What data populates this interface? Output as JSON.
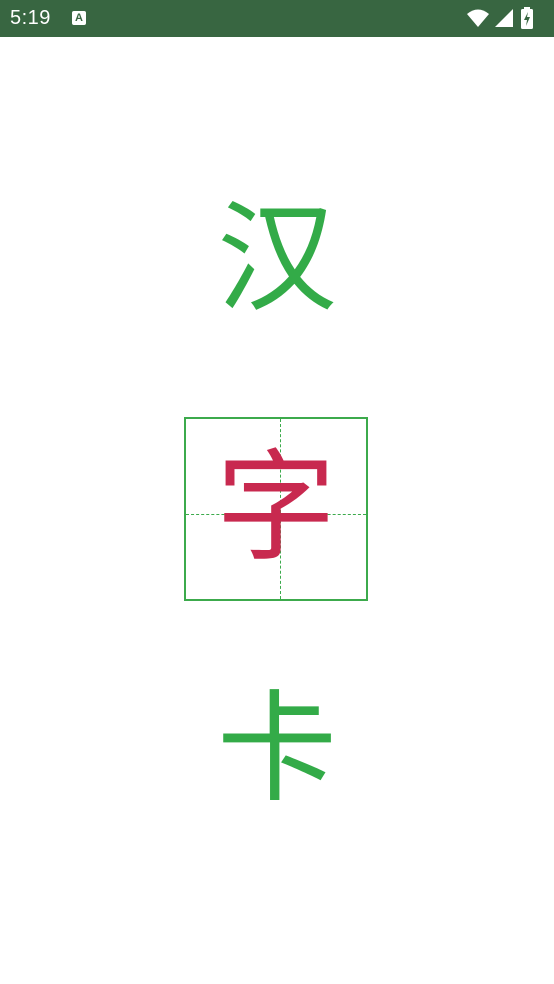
{
  "status_bar": {
    "time": "5:19",
    "notification_icon": "A",
    "icons": [
      "wifi-icon",
      "signal-icon",
      "battery-icon"
    ],
    "background_color": "#386641"
  },
  "characters": {
    "top": "汉",
    "middle": "字",
    "bottom": "卡"
  },
  "colors": {
    "character_green": "#33ab48",
    "highlight_red": "#c8294f",
    "grid_green": "#3caa4c"
  }
}
